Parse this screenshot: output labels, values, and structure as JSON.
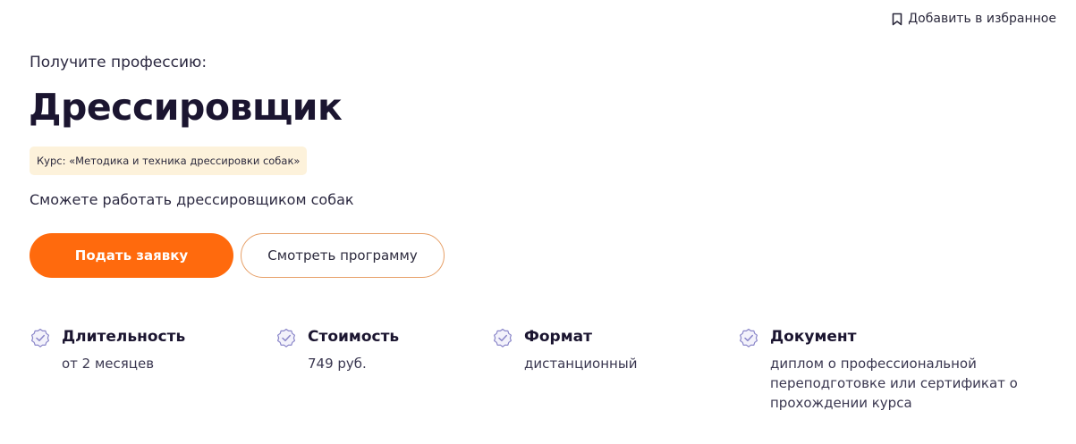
{
  "favorite": {
    "label": "Добавить в избранное",
    "icon": "bookmark-icon"
  },
  "hero": {
    "eyebrow": "Получите профессию:",
    "title": "Дрессировщик",
    "course_badge": "Курс: «Методика и техника дрессировки собак»",
    "subtitle": "Сможете работать дрессировщиком собак"
  },
  "buttons": {
    "apply_label": "Подать заявку",
    "program_label": "Смотреть программу"
  },
  "features": [
    {
      "icon": "check-badge-icon",
      "label": "Длительность",
      "value": "от 2 месяцев"
    },
    {
      "icon": "check-badge-icon",
      "label": "Стоимость",
      "value": "749 руб."
    },
    {
      "icon": "check-badge-icon",
      "label": "Формат",
      "value": "дистанционный"
    },
    {
      "icon": "check-badge-icon",
      "label": "Документ",
      "value": "диплом о профессиональной переподготовке или сертификат о прохождении курса"
    }
  ],
  "colors": {
    "accent": "#ff6a0d",
    "badge_bg": "#fdf2db",
    "icon_purple": "#8a86c9",
    "text_dark": "#1b1530"
  }
}
